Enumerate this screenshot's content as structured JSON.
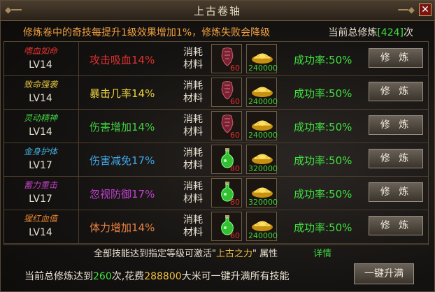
{
  "window": {
    "title": "上古卷轴",
    "close_label": "✕"
  },
  "header": {
    "notice": "修炼卷中的奇技每提升1级效果增加1%，修炼失败会降级",
    "total_prefix": "当前总修炼",
    "total_count": "[424]",
    "total_suffix": "次"
  },
  "colors": {
    "rate": "#40e040",
    "scroll_count": "#e03030",
    "gold_count": "#40d040"
  },
  "skills": [
    {
      "name": "嗜血如命",
      "name_color": "#e03030",
      "level": "LV14",
      "effect": "攻击吸血14%",
      "effect_color": "#e03030",
      "cost_label_1": "消耗",
      "cost_label_2": "材料",
      "item_icon": "red-scroll-icon",
      "item_count": "60",
      "gold": "240000",
      "rate": "成功率:50%",
      "button": "修 炼"
    },
    {
      "name": "致命强袭",
      "name_color": "#e0c040",
      "level": "LV14",
      "effect": "暴击几率14%",
      "effect_color": "#e8d040",
      "cost_label_1": "消耗",
      "cost_label_2": "材料",
      "item_icon": "red-scroll-icon",
      "item_count": "60",
      "gold": "240000",
      "rate": "成功率:50%",
      "button": "修 炼"
    },
    {
      "name": "灵动精神",
      "name_color": "#40d040",
      "level": "LV14",
      "effect": "伤害增加14%",
      "effect_color": "#40d040",
      "cost_label_1": "消耗",
      "cost_label_2": "材料",
      "item_icon": "red-scroll-icon",
      "item_count": "60",
      "gold": "240000",
      "rate": "成功率:50%",
      "button": "修 炼"
    },
    {
      "name": "金身护体",
      "name_color": "#40b0e0",
      "level": "LV17",
      "effect": "伤害减免17%",
      "effect_color": "#40a8e8",
      "cost_label_1": "消耗",
      "cost_label_2": "材料",
      "item_icon": "green-potion-icon",
      "item_count": "80",
      "gold": "320000",
      "rate": "成功率:50%",
      "button": "修 炼"
    },
    {
      "name": "蓄力重击",
      "name_color": "#c040c0",
      "level": "LV17",
      "effect": "忽视防御17%",
      "effect_color": "#c040d0",
      "cost_label_1": "消耗",
      "cost_label_2": "材料",
      "item_icon": "green-potion-icon",
      "item_count": "80",
      "gold": "320000",
      "rate": "成功率:50%",
      "button": "修 炼"
    },
    {
      "name": "猩红血值",
      "name_color": "#e08030",
      "level": "LV14",
      "effect": "体力增加14%",
      "effect_color": "#e88040",
      "cost_label_1": "消耗",
      "cost_label_2": "材料",
      "item_icon": "green-potion-icon",
      "item_count": "60",
      "gold": "240000",
      "rate": "成功率:50%",
      "button": "修 炼"
    }
  ],
  "footnote": {
    "text_a": "全部技能达到指定等级可激活\"",
    "highlight": "上古之力",
    "text_b": "\" 属性",
    "detail_link": "详情"
  },
  "bottom": {
    "text_a": "当前总修炼达到",
    "count": "260",
    "text_b": "次,花费",
    "cost": "288800",
    "text_c": "大米可一键升满所有技能",
    "button": "一键升满"
  }
}
